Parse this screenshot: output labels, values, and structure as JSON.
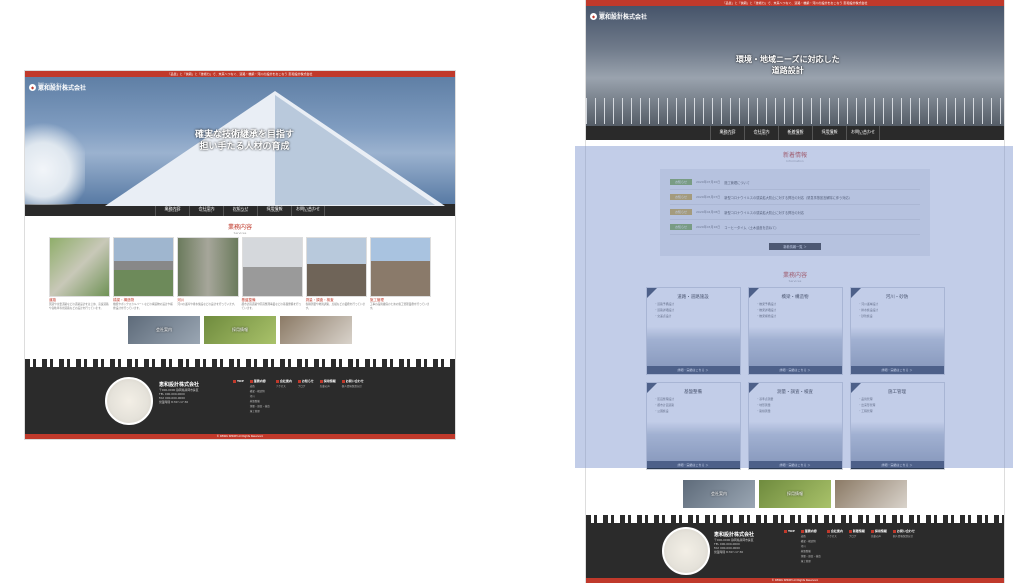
{
  "left": {
    "topbar": "「品質」と「信頼」と「技術力」で、未来へつなぐ、道路・橋梁・河川の設計をおこなう 恵和設計株式会社",
    "logo_sub": "建設コンサルタント",
    "logo_name": "恵和設計株式会社",
    "hero_lines": [
      "確実な技術継承を目指す",
      "担い手たる人材の育成"
    ],
    "nav": [
      {
        "jp": "業務内容",
        "en": "Services"
      },
      {
        "jp": "会社案内",
        "en": "Company"
      },
      {
        "jp": "お知らせ",
        "en": "Information"
      },
      {
        "jp": "採用情報",
        "en": "Careers"
      },
      {
        "jp": "お問い合わせ",
        "en": "Contact"
      }
    ],
    "services_title": "業務内容",
    "services_sub": "Services",
    "gallery": [
      {
        "cap": "道路",
        "desc": "国道や主要道路などの道路設計をはじめ、高速道路や自動車専用道路などの設計を行っています。"
      },
      {
        "cap": "橋梁・構造物",
        "desc": "橋梁やボックスカルバートなどの構造物の設計や補修設計を行っています。"
      },
      {
        "cap": "河川",
        "desc": "河川の護岸や排水施設などの設計を行っています。"
      },
      {
        "cap": "基盤整備",
        "desc": "都市計画道路や区画整理事業などの基盤整備を行っています。"
      },
      {
        "cap": "測量・調査・検査",
        "desc": "各種測量や地質調査、点検などの業務を行っています。"
      },
      {
        "cap": "施工管理",
        "desc": "工事の品質確保のための施工管理業務を行っています。"
      }
    ],
    "banners": [
      "会社案内",
      "採用情報",
      ""
    ],
    "footer": {
      "name": "恵和設計株式会社",
      "lines": [
        "〒000-0000 静岡県静岡市葵区",
        "TEL 000-000-0000",
        "FAX 000-000-0000",
        "営業時間 8:30〜17:30"
      ]
    },
    "footer_links": [
      {
        "h": "TOP",
        "items": []
      },
      {
        "h": "業務内容",
        "items": [
          "道路",
          "橋梁・構造物",
          "河川",
          "基盤整備",
          "測量・調査・検査",
          "施工管理"
        ]
      },
      {
        "h": "会社案内",
        "items": [
          "アクセス"
        ]
      },
      {
        "h": "お知らせ",
        "items": [
          "ブログ"
        ]
      },
      {
        "h": "採用情報",
        "items": [
          "先輩の声"
        ]
      },
      {
        "h": "お問い合わせ",
        "items": [
          "個人情報保護方針"
        ]
      }
    ],
    "copyright": "© KEIWA SEKKEI All Rights Reserved."
  },
  "right": {
    "topbar": "「品質」と「信頼」と「技術力」で、未来へつなぐ、道路・橋梁・河川の設計をおこなう 恵和設計株式会社",
    "logo_sub": "建設コンサルタント",
    "logo_name": "恵和設計株式会社",
    "hero_lines": [
      "環境・地域ニーズに対応した",
      "道路設計"
    ],
    "nav": [
      {
        "jp": "業務内容",
        "en": "Services"
      },
      {
        "jp": "会社案内",
        "en": "Company"
      },
      {
        "jp": "新着情報",
        "en": "Information"
      },
      {
        "jp": "採用情報",
        "en": "Careers"
      },
      {
        "jp": "お問い合わせ",
        "en": "Contact"
      }
    ],
    "news_title": "新着情報",
    "news_sub": "Information",
    "news": [
      {
        "tag": "お知らせ",
        "color": "#7aa64a",
        "date": "2020年07月20日",
        "title": "施工管理について"
      },
      {
        "tag": "お知らせ",
        "color": "#c8a53c",
        "date": "2020年05月07日",
        "title": "新型コロナウイルスの感染拡大防止に対する弊社の対応（緊急事態宣言解除に伴う対応）"
      },
      {
        "tag": "お知らせ",
        "color": "#c8a53c",
        "date": "2020年04月08日",
        "title": "新型コロナウイルスの感染拡大防止に対する弊社の対応"
      },
      {
        "tag": "お知らせ",
        "color": "#7aa64a",
        "date": "2020年03月16日",
        "title": "コーヒータイム（土木遺産を訪ねて）"
      }
    ],
    "news_button": "新着情報一覧 ＞",
    "services_title": "業務内容",
    "services_sub": "Services",
    "services": [
      {
        "t": "道路・道路施設",
        "l": [
          "・道路予備設計",
          "・道路詳細設計",
          "・交差点設計",
          "・道路付属物設計"
        ]
      },
      {
        "t": "橋梁・構造物",
        "l": [
          "・橋梁予備設計",
          "・橋梁詳細設計",
          "・橋梁補修設計",
          "・橋梁点検"
        ]
      },
      {
        "t": "河川・砂防",
        "l": [
          "・河川護岸設計",
          "・排水施設設計",
          "・砂防施設"
        ]
      },
      {
        "t": "基盤整備",
        "l": [
          "・区画整理設計",
          "・都市計画道路",
          "・公園施設"
        ]
      },
      {
        "t": "測量・調査・検査",
        "l": [
          "・基準点測量",
          "・地形測量",
          "・路線測量",
          "・地質調査"
        ]
      },
      {
        "t": "施工管理",
        "l": [
          "・品質管理",
          "・出来形管理",
          "・工程管理"
        ]
      }
    ],
    "service_button": "詳細・実績はこちら ＞",
    "banners": [
      "会社案内",
      "採用情報",
      ""
    ],
    "footer": {
      "name": "恵和設計株式会社",
      "lines": [
        "〒000-0000 静岡県静岡市葵区",
        "TEL 000-000-0000",
        "FAX 000-000-0000",
        "営業時間 8:30〜17:30"
      ]
    },
    "footer_links": [
      {
        "h": "TOP",
        "items": []
      },
      {
        "h": "業務内容",
        "items": [
          "道路",
          "橋梁・構造物",
          "河川",
          "基盤整備",
          "測量・調査・検査",
          "施工管理"
        ]
      },
      {
        "h": "会社案内",
        "items": [
          "アクセス"
        ]
      },
      {
        "h": "新着情報",
        "items": [
          "ブログ"
        ]
      },
      {
        "h": "採用情報",
        "items": [
          "先輩の声"
        ]
      },
      {
        "h": "お問い合わせ",
        "items": [
          "個人情報保護方針"
        ]
      }
    ],
    "copyright": "© KEIWA SEKKEI All Rights Reserved."
  },
  "colors": {
    "accent": "#c0392b",
    "dark": "#2a2a2a",
    "navy": "#2b3a52",
    "highlight": "#7891cd"
  }
}
